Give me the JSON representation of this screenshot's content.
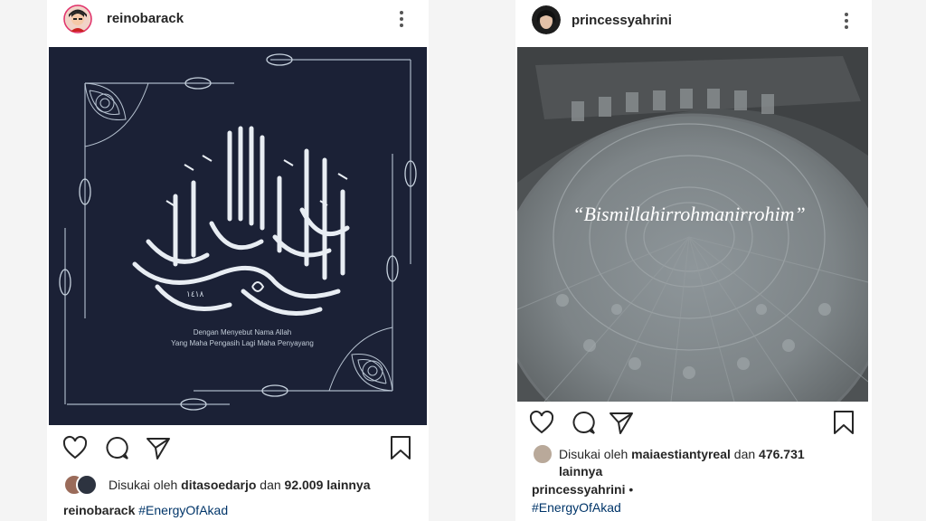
{
  "posts": [
    {
      "username": "reinobarack",
      "liked_by": "ditasoedarjo",
      "likes_connector": "dan",
      "likes_count": "92.009",
      "likes_suffix": "lainnya",
      "likes_prefix": "Disukai oleh",
      "caption_user": "reinobarack",
      "hashtag": "#EnergyOfAkad",
      "image": {
        "year": "١٤١٨",
        "line1": "Dengan Menyebut Nama Allah",
        "line2": "Yang Maha Pengasih Lagi Maha Penyayang"
      }
    },
    {
      "username": "princessyahrini",
      "liked_by": "maiaestiantyreal",
      "likes_connector": "dan",
      "likes_count": "476.731",
      "likes_suffix": "lainnya",
      "likes_prefix": "Disukai oleh",
      "caption_user": "princessyahrini",
      "caption_sep": "•",
      "hashtag": "#EnergyOfAkad",
      "image": {
        "quote": "“Bismillahirrohmanirrohim”"
      }
    }
  ],
  "icons": [
    "heart-icon",
    "comment-icon",
    "share-icon",
    "bookmark-icon",
    "more-icon"
  ],
  "colors": {
    "left_bg": "#1b2136",
    "ornament": "#c7d2de",
    "hashtag": "#003569"
  }
}
